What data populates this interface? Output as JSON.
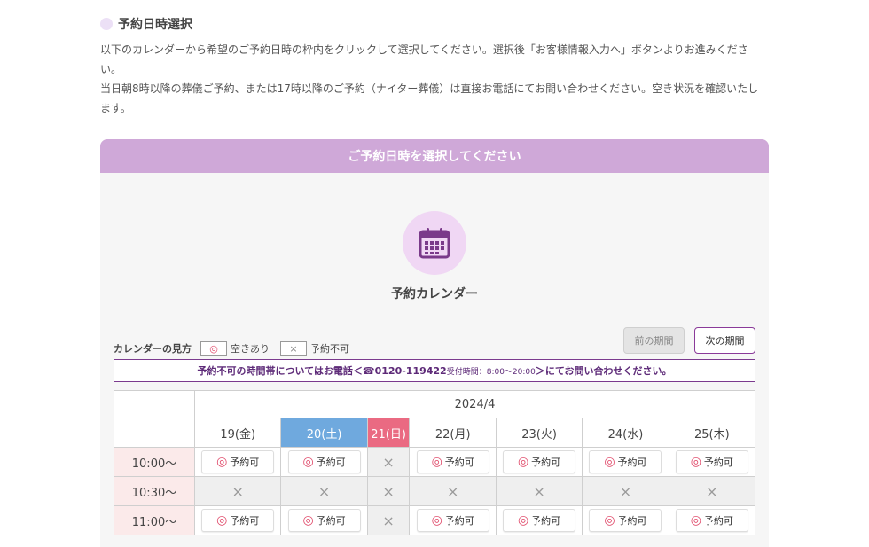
{
  "section": {
    "title": "予約日時選択",
    "intro_1": "以下のカレンダーから希望のご予約日時の枠内をクリックして選択してください。選択後「お客様情報入力へ」ボタンよりお進みください。",
    "intro_2": "当日朝8時以降の葬儀ご予約、または17時以降のご予約（ナイター葬儀）は直接お電話にてお問い合わせください。空き状況を確認いたします。"
  },
  "panel": {
    "header": "ご予約日時を選択してください",
    "calendar_title": "予約カレンダー",
    "icon": "calendar-icon"
  },
  "legend": {
    "label": "カレンダーの見方",
    "ok_symbol": "◎",
    "ok_text": "空きあり",
    "ng_symbol": "×",
    "ng_text": "予約不可"
  },
  "nav": {
    "prev": "前の期間",
    "next": "次の期間"
  },
  "notice": {
    "before": "予約不可の時間帯についてはお電話＜☎0120-119422 ",
    "hours": "受付時間：8:00～20:00",
    "after": "＞にてお問い合わせください。"
  },
  "calendar": {
    "month": "2024/4",
    "days": [
      {
        "label": "19(金)",
        "type": "weekday"
      },
      {
        "label": "20(土)",
        "type": "sat"
      },
      {
        "label": "21(日)",
        "type": "sun"
      },
      {
        "label": "22(月)",
        "type": "weekday"
      },
      {
        "label": "23(火)",
        "type": "weekday"
      },
      {
        "label": "24(水)",
        "type": "weekday"
      },
      {
        "label": "25(木)",
        "type": "weekday"
      }
    ],
    "ok_label": "予約可",
    "ok_symbol": "◎",
    "ng_symbol": "×",
    "rows": [
      {
        "time": "10:00～",
        "slots": [
          true,
          true,
          false,
          true,
          true,
          true,
          true
        ]
      },
      {
        "time": "10:30～",
        "slots": [
          false,
          false,
          false,
          false,
          false,
          false,
          false
        ]
      },
      {
        "time": "11:00～",
        "slots": [
          true,
          true,
          false,
          true,
          true,
          true,
          true
        ]
      }
    ]
  },
  "colors": {
    "header_purple": "#cfa8d8",
    "sat_blue": "#6fa9de",
    "sun_red": "#ea6a82",
    "ok_red": "#e04a6a"
  }
}
